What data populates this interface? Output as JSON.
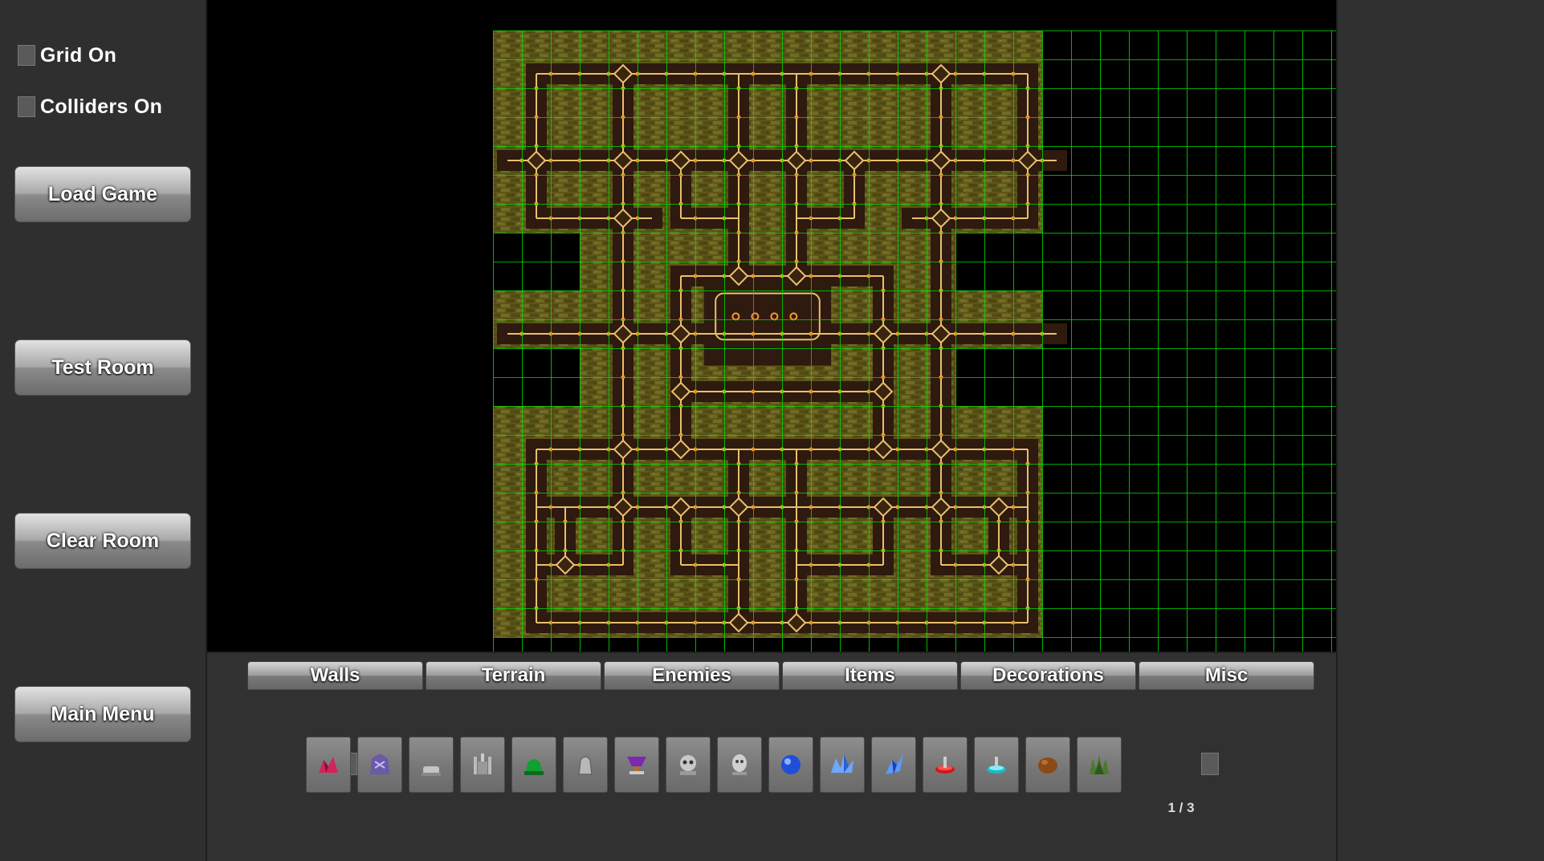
{
  "sidebar": {
    "toggles": [
      {
        "label": "Grid On",
        "checked": false
      },
      {
        "label": "Colliders On",
        "checked": false
      }
    ],
    "buttons": [
      "Load Game",
      "Test Room",
      "Clear Room",
      "Main Menu"
    ]
  },
  "editor": {
    "grid_color": "#00ff00",
    "floor_color": "#5e5517",
    "path_color": "#2e1a0e",
    "rail_color": "#e8c070"
  },
  "palette": {
    "tabs": [
      "Walls",
      "Terrain",
      "Enemies",
      "Items",
      "Decorations",
      "Misc"
    ],
    "items": [
      {
        "icon": "red-crystal-cluster-icon"
      },
      {
        "icon": "purple-dragon-statue-icon"
      },
      {
        "icon": "gray-tombstone-icon"
      },
      {
        "icon": "stone-throne-icon"
      },
      {
        "icon": "green-pedestal-icon"
      },
      {
        "icon": "stone-altar-icon"
      },
      {
        "icon": "purple-chalice-icon"
      },
      {
        "icon": "skull-statue-icon"
      },
      {
        "icon": "stone-face-statue-icon"
      },
      {
        "icon": "blue-orb-icon"
      },
      {
        "icon": "blue-crystal-cluster-icon"
      },
      {
        "icon": "blue-crystal-shard-icon"
      },
      {
        "icon": "red-fountain-icon"
      },
      {
        "icon": "cyan-fountain-icon"
      },
      {
        "icon": "brown-boulder-icon"
      },
      {
        "icon": "green-bush-icon"
      }
    ],
    "page": "1 / 3"
  }
}
